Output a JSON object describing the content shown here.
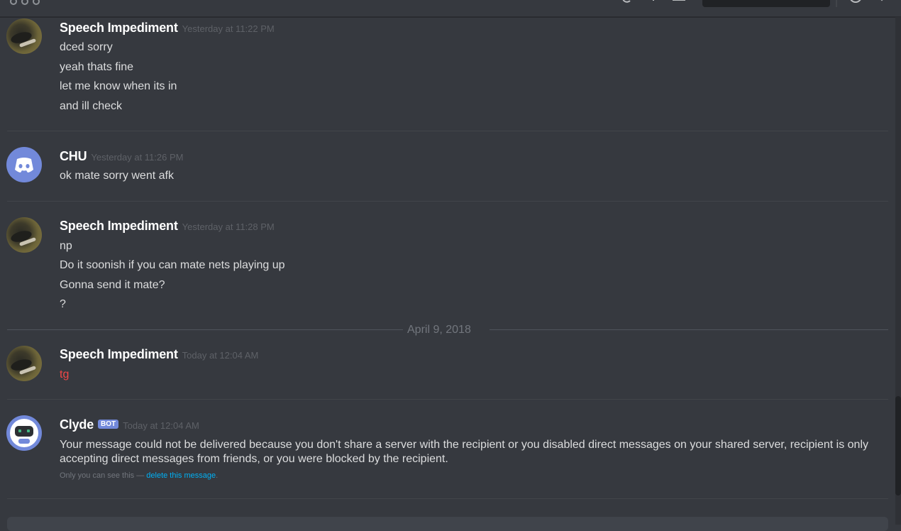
{
  "messages": [
    {
      "author": "Speech Impediment",
      "timestamp": "Yesterday at 11:22 PM",
      "lines": [
        "dced sorry",
        "yeah thats fine",
        "let me know when its in",
        "and ill check"
      ]
    },
    {
      "author": "CHU",
      "timestamp": "Yesterday at 11:26 PM",
      "lines": [
        "ok mate sorry went afk"
      ]
    },
    {
      "author": "Speech Impediment",
      "timestamp": "Yesterday at 11:28 PM",
      "lines": [
        "np",
        "Do it soonish if you can mate nets playing up",
        "Gonna send it mate?",
        "?"
      ]
    },
    {
      "author": "Speech Impediment",
      "timestamp": "Today at 12:04 AM",
      "lines": [
        "tg"
      ]
    },
    {
      "author": "Clyde",
      "bot_tag": "BOT",
      "timestamp": "Today at 12:04 AM",
      "text": "Your message could not be delivered because you don't share a server with the recipient or you disabled direct messages on your shared server, recipient is only accepting direct messages from friends, or you were blocked by the recipient.",
      "only_you_prefix": "Only you can see this — ",
      "delete_link": "delete this message",
      "only_you_suffix": "."
    }
  ],
  "date_divider": "April 9, 2018",
  "colors": {
    "background": "#36393f",
    "failed_message": "#f04747",
    "link": "#00b0f4",
    "bot_tag": "#7289da"
  },
  "icons": [
    "window-dots-icon",
    "discord-logo-icon",
    "clyde-robot-icon",
    "inbox-icon",
    "help-icon"
  ]
}
